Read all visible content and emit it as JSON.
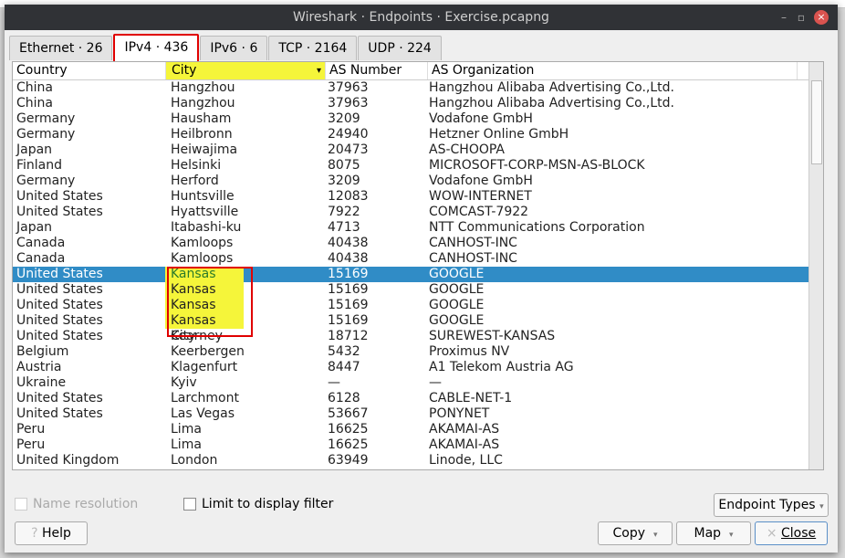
{
  "window": {
    "title": "Wireshark · Endpoints · Exercise.pcapng",
    "minimize": "–",
    "maximize": "▫",
    "close": "×"
  },
  "tabs": [
    {
      "label": "Ethernet · 26"
    },
    {
      "label": "IPv4 · 436"
    },
    {
      "label": "IPv6 · 6"
    },
    {
      "label": "TCP · 2164"
    },
    {
      "label": "UDP · 224"
    }
  ],
  "columns": [
    "Country",
    "City",
    "AS Number",
    "AS Organization"
  ],
  "sort_indicator": "▾",
  "rows": [
    [
      "China",
      "Hangzhou",
      "37963",
      "Hangzhou Alibaba Advertising Co.,Ltd."
    ],
    [
      "China",
      "Hangzhou",
      "37963",
      "Hangzhou Alibaba Advertising Co.,Ltd."
    ],
    [
      "Germany",
      "Hausham",
      "3209",
      "Vodafone GmbH"
    ],
    [
      "Germany",
      "Heilbronn",
      "24940",
      "Hetzner Online GmbH"
    ],
    [
      "Japan",
      "Heiwajima",
      "20473",
      "AS-CHOOPA"
    ],
    [
      "Finland",
      "Helsinki",
      "8075",
      "MICROSOFT-CORP-MSN-AS-BLOCK"
    ],
    [
      "Germany",
      "Herford",
      "3209",
      "Vodafone GmbH"
    ],
    [
      "United States",
      "Huntsville",
      "12083",
      "WOW-INTERNET"
    ],
    [
      "United States",
      "Hyattsville",
      "7922",
      "COMCAST-7922"
    ],
    [
      "Japan",
      "Itabashi-ku",
      "4713",
      "NTT Communications Corporation"
    ],
    [
      "Canada",
      "Kamloops",
      "40438",
      "CANHOST-INC"
    ],
    [
      "Canada",
      "Kamloops",
      "40438",
      "CANHOST-INC"
    ],
    [
      "United States",
      "Kansas City",
      "15169",
      "GOOGLE"
    ],
    [
      "United States",
      "Kansas City",
      "15169",
      "GOOGLE"
    ],
    [
      "United States",
      "Kansas City",
      "15169",
      "GOOGLE"
    ],
    [
      "United States",
      "Kansas City",
      "15169",
      "GOOGLE"
    ],
    [
      "United States",
      "Kearney",
      "18712",
      "SUREWEST-KANSAS"
    ],
    [
      "Belgium",
      "Keerbergen",
      "5432",
      "Proximus NV"
    ],
    [
      "Austria",
      "Klagenfurt",
      "8447",
      "A1 Telekom Austria AG"
    ],
    [
      "Ukraine",
      "Kyiv",
      "—",
      "—"
    ],
    [
      "United States",
      "Larchmont",
      "6128",
      "CABLE-NET-1"
    ],
    [
      "United States",
      "Las Vegas",
      "53667",
      "PONYNET"
    ],
    [
      "Peru",
      "Lima",
      "16625",
      "AKAMAI-AS"
    ],
    [
      "Peru",
      "Lima",
      "16625",
      "AKAMAI-AS"
    ],
    [
      "United Kingdom",
      "London",
      "63949",
      "Linode, LLC"
    ]
  ],
  "selected_row": 12,
  "options": {
    "name_resolution": "Name resolution",
    "limit_filter": "Limit to display filter",
    "endpoint_types": "Endpoint Types"
  },
  "buttons": {
    "help": "Help",
    "help_icon": "?",
    "copy": "Copy",
    "map": "Map",
    "close": "Close",
    "close_icon": "×",
    "dropdown": "▾"
  }
}
